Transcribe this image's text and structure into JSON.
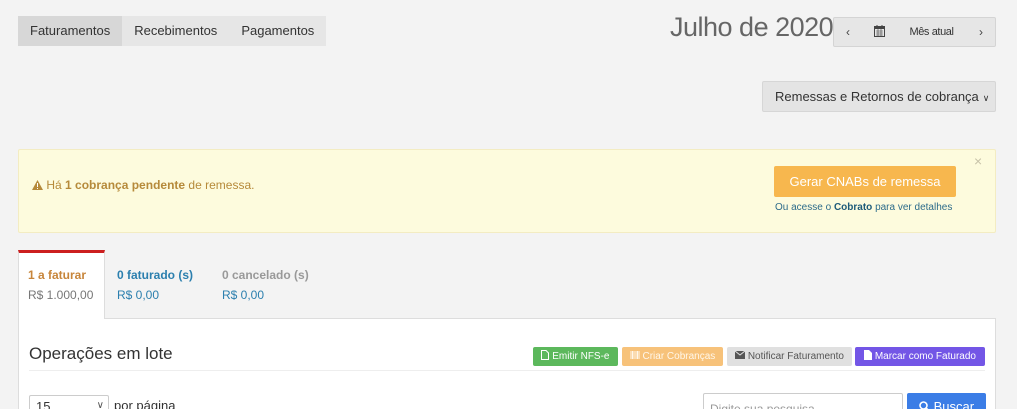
{
  "top_tabs": [
    "Faturamentos",
    "Recebimentos",
    "Pagamentos"
  ],
  "month_title": "Julho de 2020",
  "month_nav": {
    "prev_icon": "‹",
    "calendar_icon": "calendar-icon",
    "current_label": "Mês atual",
    "next_icon": "›"
  },
  "remessas_label": "Remessas e Retornos de cobrança",
  "alert": {
    "prefix": "Há",
    "bold": "1 cobrança pendente",
    "suffix": "de remessa.",
    "close": "×",
    "cnab_button": "Gerar CNABs de remessa",
    "link_prefix": "Ou acesse o",
    "link_bold": "Cobrato",
    "link_suffix": "para ver detalhes"
  },
  "status_tabs": [
    {
      "title": "1 a faturar",
      "value": "R$ 1.000,00"
    },
    {
      "title": "0 faturado (s)",
      "value": "R$ 0,00"
    },
    {
      "title": "0 cancelado (s)",
      "value": "R$ 0,00"
    }
  ],
  "panel": {
    "title": "Operações em lote",
    "buttons": {
      "nfse": "Emitir NFS-e",
      "criar": "Criar Cobranças",
      "notificar": "Notificar Faturamento",
      "marcar": "Marcar como Faturado"
    },
    "per_page_value": "15",
    "per_page_label": "por página",
    "search_placeholder": "Digite sua pesquisa",
    "search_button": "Buscar"
  },
  "colors": {
    "accent_red": "#cc1f1f",
    "cnab_orange": "#f7b74e",
    "search_blue": "#3b7de6",
    "purple": "#7356e6",
    "green": "#5cb85c"
  }
}
